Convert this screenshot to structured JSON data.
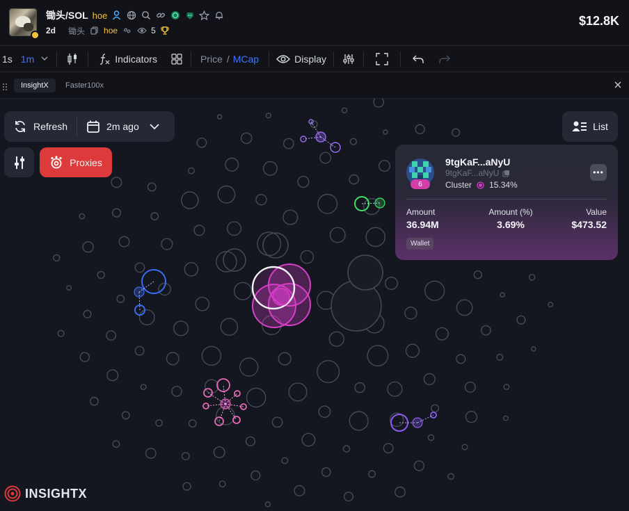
{
  "header": {
    "pair": "锄头/SOL",
    "tag": "hoe",
    "age": "2d",
    "token_name": "锄头",
    "ticker": "hoe",
    "watchers": "5",
    "market_cap": "$12.8K"
  },
  "toolbar": {
    "interval_1s": "1s",
    "interval_1m": "1m",
    "indicators": "Indicators",
    "price": "Price",
    "slash": "/",
    "mcap": "MCap",
    "display": "Display"
  },
  "tabs": {
    "insightx": "InsightX",
    "faster": "Faster100x"
  },
  "map": {
    "refresh": "Refresh",
    "time_ago": "2m ago",
    "list": "List",
    "proxies": "Proxies",
    "logo": "INSIGHTX"
  },
  "wallet_card": {
    "address": "9tgKaF...aNyU",
    "address_sub": "9tgKaF...aNyU",
    "badge": "6",
    "cluster_label": "Cluster",
    "cluster_pct": "15.34%",
    "amount_label": "Amount",
    "amount_value": "36.94M",
    "amount_pct_label": "Amount (%)",
    "amount_pct_value": "3.69%",
    "value_label": "Value",
    "value_value": "$473.52",
    "tag": "Wallet"
  },
  "colors": {
    "accent_blue": "#3f73ff",
    "proxies_red": "#dd3b3b",
    "cluster_pink": "#d63fc8",
    "cluster_purple": "#8a5cf0",
    "cluster_green": "#3ee066",
    "cluster_blue": "#3a6df2",
    "gold": "#f0c23a"
  }
}
